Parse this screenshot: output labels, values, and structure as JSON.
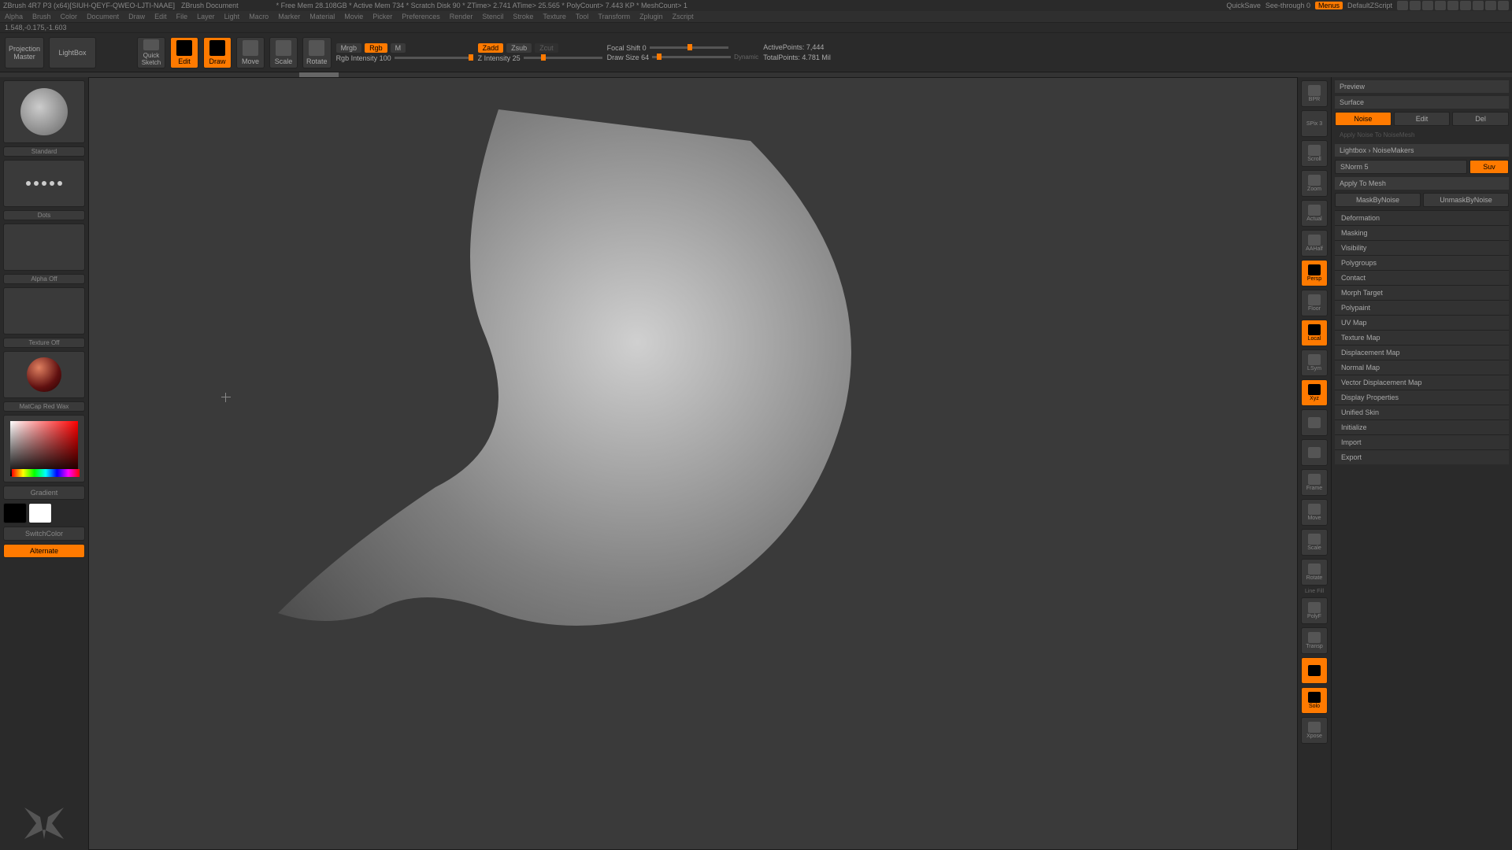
{
  "titlebar": {
    "app": "ZBrush 4R7 P3 (x64)[SIUH-QEYF-QWEO-LJTI-NAAE]",
    "doc": "ZBrush Document",
    "stats": "* Free Mem 28.108GB * Active Mem 734 * Scratch Disk 90 * ZTime> 2.741 ATime> 25.565 * PolyCount> 7.443 KP * MeshCount> 1",
    "quicksave": "QuickSave",
    "seethrough": "See-through  0",
    "menus": "Menus",
    "script": "DefaultZScript"
  },
  "menu": [
    "Alpha",
    "Brush",
    "Color",
    "Document",
    "Draw",
    "Edit",
    "File",
    "Layer",
    "Light",
    "Macro",
    "Marker",
    "Material",
    "Movie",
    "Picker",
    "Preferences",
    "Render",
    "Stencil",
    "Stroke",
    "Texture",
    "Tool",
    "Transform",
    "Zplugin",
    "Zscript"
  ],
  "coords": "1.548,-0.175,-1.603",
  "toolbar": {
    "projection": "Projection\nMaster",
    "lightbox": "LightBox",
    "quicksketch": "Quick\nSketch",
    "edit": "Edit",
    "draw": "Draw",
    "move": "Move",
    "scale": "Scale",
    "rotate": "Rotate",
    "mrgb": "Mrgb",
    "rgb": "Rgb",
    "m": "M",
    "rgbintensity": "Rgb Intensity 100",
    "zadd": "Zadd",
    "zsub": "Zsub",
    "zcut": "Zcut",
    "zintensity": "Z Intensity 25",
    "focalshift": "Focal Shift 0",
    "drawsize": "Draw Size 64",
    "dynamic": "Dynamic",
    "activepoints": "ActivePoints: 7,444",
    "totalpoints": "TotalPoints: 4.781 Mil"
  },
  "leftshelf": {
    "brush": "Standard",
    "stroke": "Dots",
    "alpha": "Alpha Off",
    "texture": "Texture Off",
    "material": "MatCap Red Wax",
    "gradient": "Gradient",
    "switchcolor": "SwitchColor",
    "alternate": "Alternate"
  },
  "rnav": [
    {
      "label": "BPR",
      "active": false
    },
    {
      "label": "SPix 3",
      "active": false,
      "text": true
    },
    {
      "label": "Scroll",
      "active": false
    },
    {
      "label": "Zoom",
      "active": false
    },
    {
      "label": "Actual",
      "active": false
    },
    {
      "label": "AAHalf",
      "active": false
    },
    {
      "label": "Persp",
      "active": true
    },
    {
      "label": "Floor",
      "active": false
    },
    {
      "label": "Local",
      "active": true
    },
    {
      "label": "LSym",
      "active": false
    },
    {
      "label": "Xyz",
      "active": true
    },
    {
      "label": "",
      "active": false
    },
    {
      "label": "",
      "active": false
    },
    {
      "label": "Frame",
      "active": false
    },
    {
      "label": "Move",
      "active": false
    },
    {
      "label": "Scale",
      "active": false
    },
    {
      "label": "Rotate",
      "active": false
    },
    {
      "label": "PolyF",
      "active": false,
      "header": "Line Fill"
    },
    {
      "label": "Transp",
      "active": false
    },
    {
      "label": "",
      "active": true
    },
    {
      "label": "Solo",
      "active": true
    },
    {
      "label": "Xpose",
      "active": false
    }
  ],
  "rpanel": {
    "preview": "Preview",
    "surface": "Surface",
    "noise": "Noise",
    "edit": "Edit",
    "del": "Del",
    "applynoise": "Apply Noise To NoiseMesh",
    "lightbox": "Lightbox › NoiseMakers",
    "snorm": "SNorm 5",
    "suv": "Suv",
    "applymesh": "Apply To Mesh",
    "maskbynoise": "MaskByNoise",
    "unmaskbynoise": "UnmaskByNoise",
    "sections": [
      "Deformation",
      "Masking",
      "Visibility",
      "Polygroups",
      "Contact",
      "Morph Target",
      "Polypaint",
      "UV Map",
      "Texture Map",
      "Displacement Map",
      "Normal Map",
      "Vector Displacement Map",
      "Display Properties",
      "Unified Skin",
      "Initialize",
      "Import",
      "Export"
    ]
  }
}
